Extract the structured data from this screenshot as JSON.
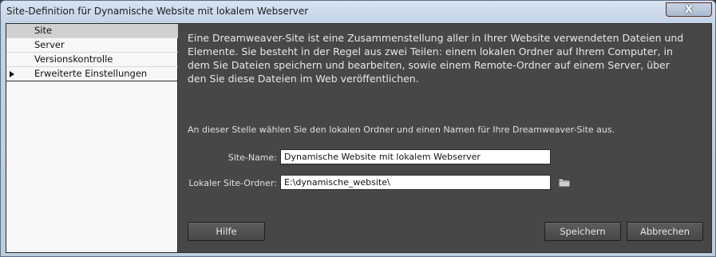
{
  "window": {
    "title": "Site-Definition für Dynamische Website mit lokalem Webserver",
    "close_glyph": "X"
  },
  "sidebar": {
    "items": [
      {
        "label": "Site",
        "selected": true
      },
      {
        "label": "Server"
      },
      {
        "label": "Versionskontrolle"
      },
      {
        "label": "Erweiterte Einstellungen",
        "expandable": true
      }
    ]
  },
  "main": {
    "intro_lines": [
      "Eine Dreamweaver-Site ist eine Zusammenstellung aller in Ihrer Website verwendeten Dateien und",
      "Elemente. Sie besteht in der Regel aus zwei Teilen: einem lokalen Ordner auf Ihrem Computer, in",
      "dem Sie Dateien speichern und bearbeiten, sowie einem Remote-Ordner auf einem Server, über",
      "den Sie diese Dateien im Web veröffentlichen."
    ],
    "hint": "An dieser Stelle wählen Sie den lokalen Ordner und einen Namen für Ihre Dreamweaver-Site aus.",
    "site_name_label": "Site-Name:",
    "site_name_value": "Dynamische Website mit lokalem Webserver",
    "local_folder_label": "Lokaler Site-Ordner:",
    "local_folder_value": "E:\\dynamische_website\\",
    "folder_icon": "folder-icon"
  },
  "buttons": {
    "help": "Hilfe",
    "save": "Speichern",
    "cancel": "Abbrechen"
  },
  "colors": {
    "panel_bg": "#474747",
    "sidebar_bg": "#f7f7f7",
    "selected_bg": "#d0d0d0",
    "titlebar": "#c3d2e6"
  }
}
